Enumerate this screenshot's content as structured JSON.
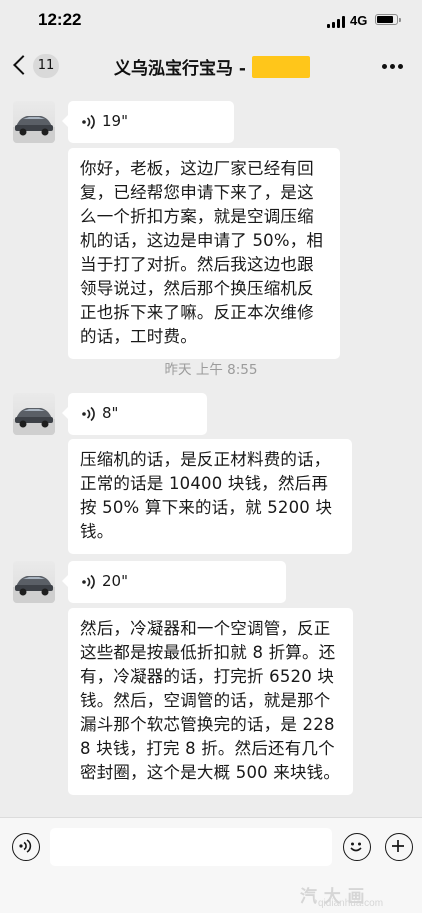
{
  "status_bar": {
    "time": "12:22",
    "network": "4G"
  },
  "nav": {
    "unread_count": "11",
    "title": "义乌泓宝行宝马 -",
    "redaction_color": "#ffc61a"
  },
  "messages": [
    {
      "type": "voice",
      "duration": "19\""
    },
    {
      "type": "text",
      "text": "你好，老板，这边厂家已经有回复，已经帮您申请下来了，是这么一个折扣方案，就是空调压缩机的话，这边是申请了 50%，相当于打了对折。然后我这边也跟领导说过，然后那个换压缩机反正也拆下来了嘛。反正本次维修的话，工时费。"
    },
    {
      "type": "timestamp",
      "text": "昨天 上午 8:55"
    },
    {
      "type": "voice",
      "duration": "8\""
    },
    {
      "type": "text",
      "text": "压缩机的话，是反正材料费的话，正常的话是 10400 块钱，然后再按 50% 算下来的话，就 5200 块钱。"
    },
    {
      "type": "voice",
      "duration": "20\""
    },
    {
      "type": "text",
      "text": "然后，冷凝器和一个空调管，反正这些都是按最低折扣就 8 折算。还有，冷凝器的话，打完折 6520 块钱。然后，空调管的话，就是那个漏斗那个软芯管换完的话，是 2288 块钱，打完 8 折。然后还有几个密封圈，这个是大概 500 来块钱。"
    }
  ],
  "input_bar": {
    "placeholder": "",
    "voice_icon": "voice-mode-icon",
    "emoji_icon": "emoji-icon",
    "plus_icon": "plus-icon"
  },
  "watermark": {
    "main": "汽 大 画",
    "sub": "qidianhua.com"
  },
  "colors": {
    "background": "#ededed",
    "bubble": "#ffffff",
    "timestamp": "#9b9b9b"
  }
}
